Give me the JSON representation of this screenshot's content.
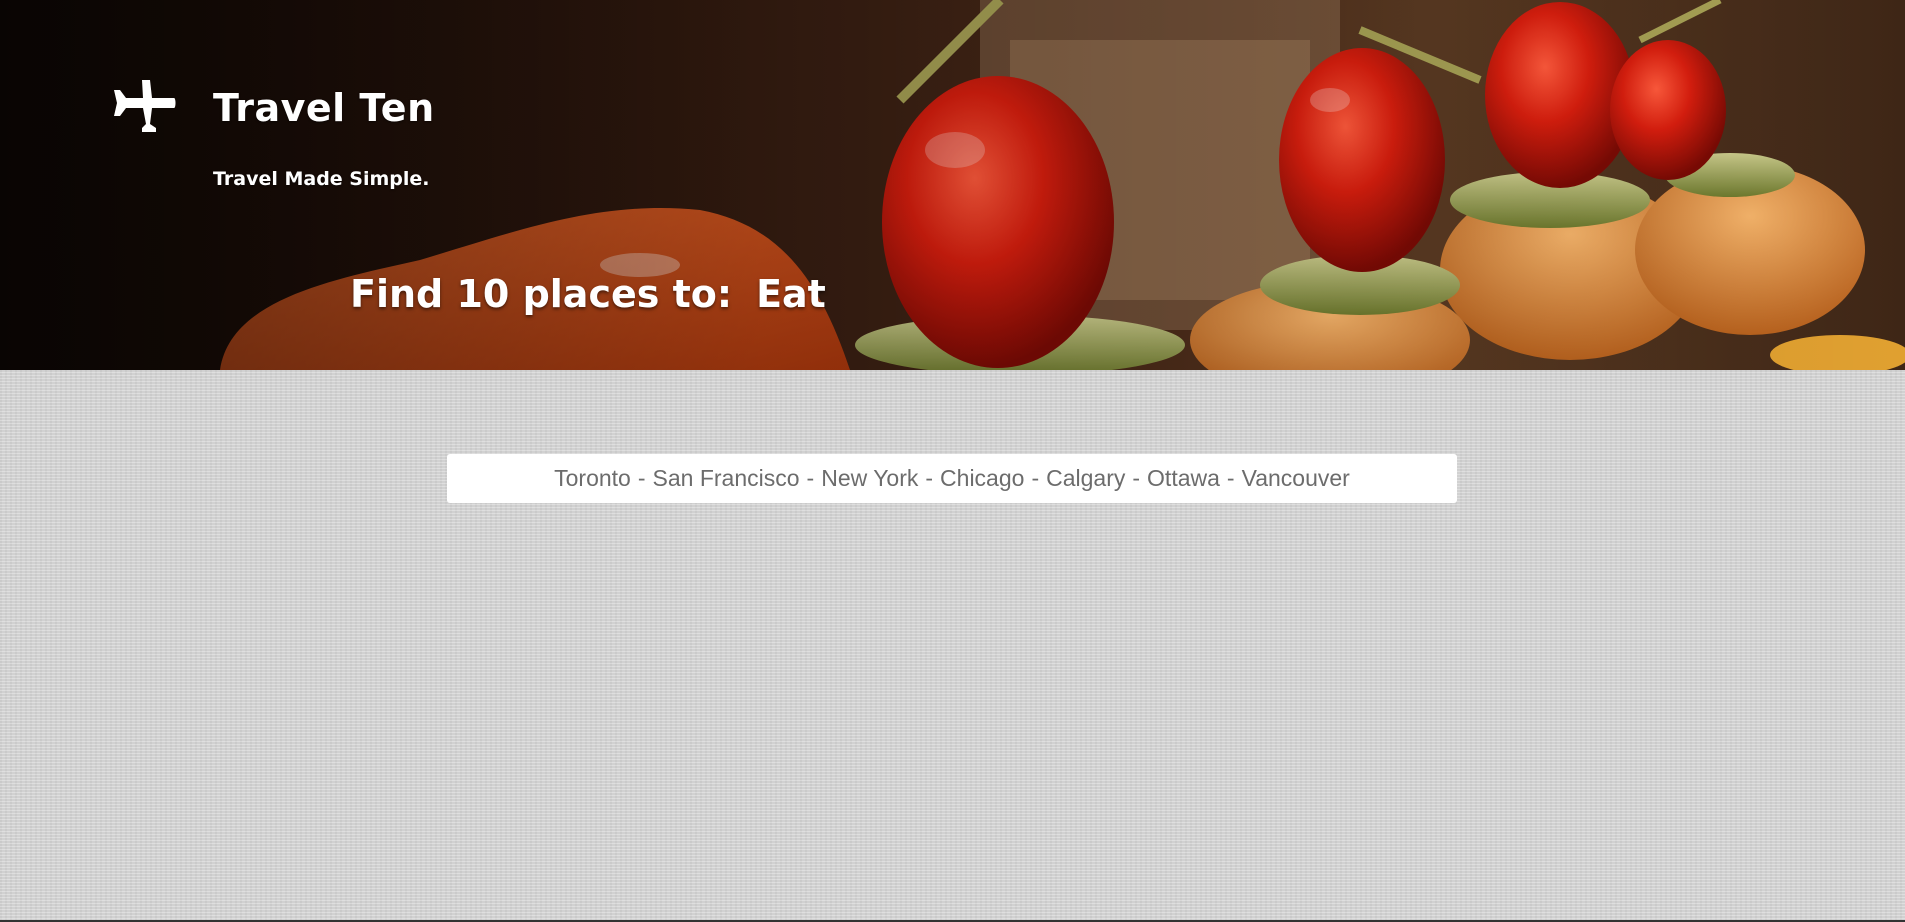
{
  "brand": {
    "icon": "airplane-icon",
    "title": "Travel Ten",
    "tagline": "Travel Made Simple."
  },
  "headline": {
    "prefix": "Find 10 places to:",
    "activity": "Eat"
  },
  "hero_image": "food-appetizers-photo",
  "cities": {
    "separator": "-",
    "items": [
      "Toronto",
      "San Francisco",
      "New York",
      "Chicago",
      "Calgary",
      "Ottawa",
      "Vancouver"
    ]
  },
  "colors": {
    "content_background": "#d6d6d6",
    "text_light": "#ffffff",
    "city_text": "#6c6c6c"
  }
}
